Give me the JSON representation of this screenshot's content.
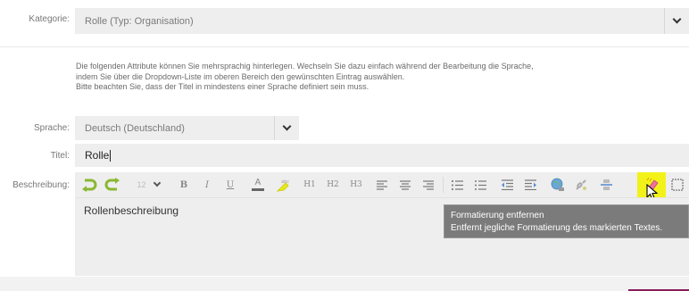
{
  "kategorie": {
    "label": "Kategorie:",
    "value": "Rolle (Typ: Organisation)"
  },
  "info": {
    "line1": "Die folgenden Attribute können Sie mehrsprachig hinterlegen. Wechseln Sie dazu einfach während der Bearbeitung die Sprache,",
    "line2": "indem Sie über die Dropdown-Liste im oberen Bereich den gewünschten Eintrag auswählen.",
    "line3": "Bitte beachten Sie, dass der Titel in mindestens einer Sprache definiert sein muss."
  },
  "sprache": {
    "label": "Sprache:",
    "value": "Deutsch (Deutschland)"
  },
  "titel": {
    "label": "Titel:",
    "value": "Rolle"
  },
  "beschreibung": {
    "label": "Beschreibung:",
    "content": "Rollenbeschreibung"
  },
  "toolbar": {
    "font_size": "12",
    "bold": "B",
    "italic": "I",
    "underline": "U",
    "font_color": "A",
    "h1": "H1",
    "h2": "H2",
    "h3": "H3"
  },
  "tooltip": {
    "title": "Formatierung entfernen",
    "description": "Entfernt jegliche Formatierung des markierten Textes."
  },
  "colors": {
    "undo_redo": "#8ab832",
    "highlight": "#f2f21a",
    "tooltip_bg": "#7b7b7b",
    "footer_accent": "#8a1d5a"
  }
}
